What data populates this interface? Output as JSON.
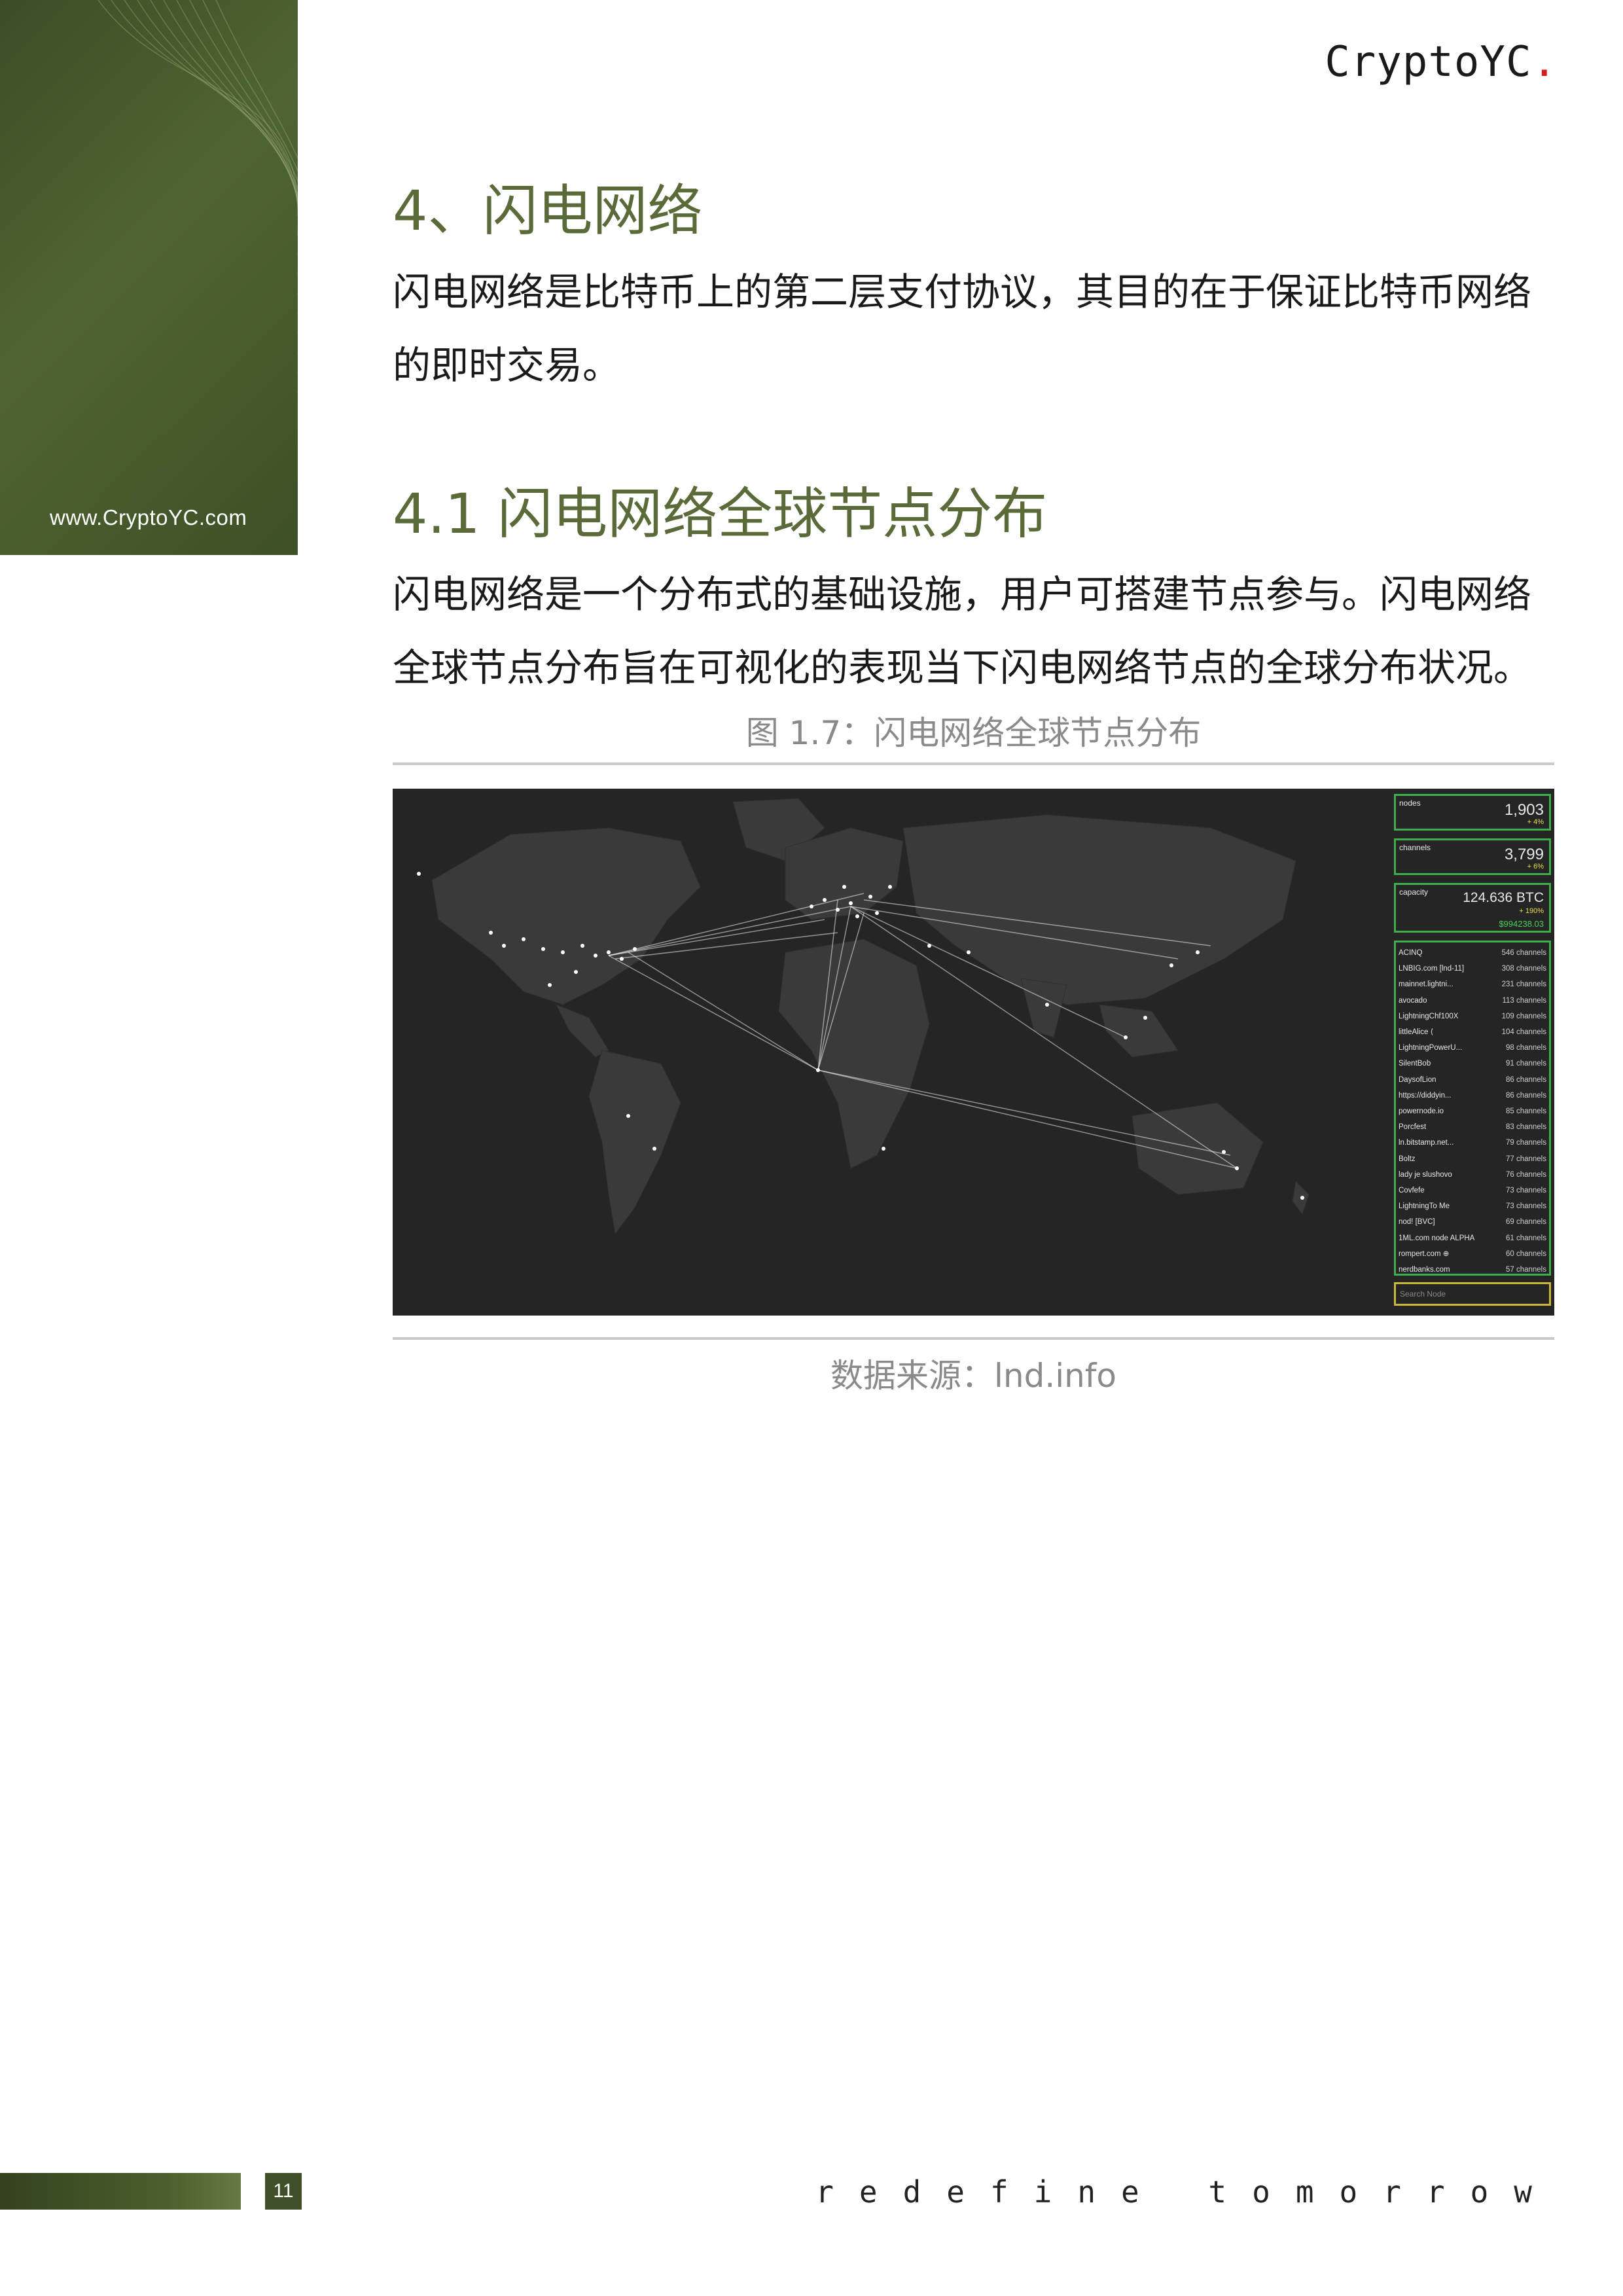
{
  "header": {
    "logo_text": "CryptoYC",
    "logo_dot": "."
  },
  "sidebar": {
    "url": "www.CryptoYC.com"
  },
  "section": {
    "title": "4、闪电网络",
    "intro": "闪电网络是比特币上的第二层支付协议，其目的在于保证比特币网络的即时交易。"
  },
  "subsection": {
    "title": "4.1 闪电网络全球节点分布",
    "body": "闪电网络是一个分布式的基础设施，用户可搭建节点参与。闪电网络全球节点分布旨在可视化的表现当下闪电网络节点的全球分布状况。"
  },
  "figure": {
    "caption": "图 1.7：闪电网络全球节点分布",
    "source": "数据来源：lnd.info",
    "stats": {
      "nodes": {
        "label": "nodes",
        "value": "1,903",
        "change": "+ 4%"
      },
      "channels": {
        "label": "channels",
        "value": "3,799",
        "change": "+ 6%"
      },
      "capacity": {
        "label": "capacity",
        "value": "124.636 BTC",
        "change": "+ 190%",
        "usd": "$994238.03"
      }
    },
    "nodes": [
      {
        "name": "ACINQ",
        "channels": "546 channels"
      },
      {
        "name": "LNBIG.com [lnd-11]",
        "channels": "308 channels"
      },
      {
        "name": "mainnet.lightni...",
        "channels": "231 channels"
      },
      {
        "name": "avocado",
        "channels": "113 channels"
      },
      {
        "name": "LightningChf100X",
        "channels": "109 channels"
      },
      {
        "name": "littleAlice ⟨",
        "channels": "104 channels"
      },
      {
        "name": "LightningPowerU...",
        "channels": "98 channels"
      },
      {
        "name": "SilentBob",
        "channels": "91 channels"
      },
      {
        "name": "DaysofLion",
        "channels": "86 channels"
      },
      {
        "name": "https://diddyin...",
        "channels": "86 channels"
      },
      {
        "name": "powernode.io",
        "channels": "85 channels"
      },
      {
        "name": "Porcfest",
        "channels": "83 channels"
      },
      {
        "name": "ln.bitstamp.net...",
        "channels": "79 channels"
      },
      {
        "name": "Boltz",
        "channels": "77 channels"
      },
      {
        "name": "lady je slushovo",
        "channels": "76 channels"
      },
      {
        "name": "Covfefe",
        "channels": "73 channels"
      },
      {
        "name": "LightningTo Me",
        "channels": "73 channels"
      },
      {
        "name": "nod! [BVC]",
        "channels": "69 channels"
      },
      {
        "name": "1ML.com node ALPHA",
        "channels": "61 channels"
      },
      {
        "name": "rompert.com ⊕",
        "channels": "60 channels"
      },
      {
        "name": "nerdbanks.com",
        "channels": "57 channels"
      }
    ],
    "search_placeholder": "Search Node"
  },
  "footer": {
    "page": "11",
    "tagline": "redefine tomorrow"
  },
  "colors": {
    "accent": "#5a6b39",
    "sidebar": "#4f6432",
    "logo_dot": "#d21f1f",
    "panel_border": "#3fae4a"
  }
}
